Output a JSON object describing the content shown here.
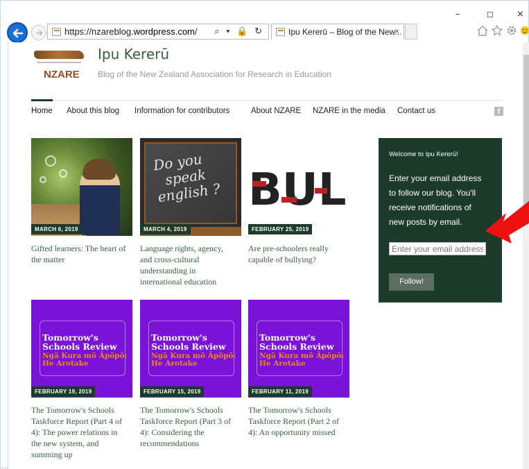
{
  "window": {
    "minimize": "–",
    "maximize": "☐",
    "close": "×"
  },
  "browser": {
    "url_prefix": "https://nzareblog.",
    "url_domain": "wordpress.com",
    "url_suffix": "/",
    "address_tools": "⌕ ▾ 🔒 ↻",
    "tab_title": "Ipu Kererū – Blog of the New...",
    "tab_close": "×",
    "icons": [
      "home-icon",
      "star-icon",
      "gear-icon",
      "smiley-icon"
    ]
  },
  "site": {
    "logo_text": "NZARE",
    "title": "Ipu Kererū",
    "tagline": "Blog of the New Zealand Association for Research in Education"
  },
  "nav": {
    "items": [
      "Home",
      "About this blog",
      "Information for contributors",
      "About NZARE",
      "NZARE in the media",
      "Contact us"
    ],
    "social": "f"
  },
  "posts": [
    {
      "date": "MARCH 6, 2019",
      "title": [
        "Gifted learners: The heart of",
        "the matter"
      ]
    },
    {
      "date": "MARCH 4, 2019",
      "title": [
        "Language rights, agency,",
        "and cross-cultural",
        "understanding in",
        "international education"
      ],
      "image_text": [
        "Do you",
        "speak",
        "english ?"
      ]
    },
    {
      "date": "FEBRUARY 25, 2019",
      "title": [
        "Are pre-schoolers really",
        "capable of bullying?"
      ],
      "image_text": "BULLY"
    },
    {
      "date": "FEBRUARY 19, 2019",
      "title": [
        "The Tomorrow's Schools",
        "Taskforce Report (Part 4 of",
        "4): The power relations in",
        "the new system, and",
        "summing up"
      ]
    },
    {
      "date": "FEBRUARY 15, 2019",
      "title": [
        "The Tomorrow's Schools",
        "Taskforce Report (Part 3 of",
        "4): Considering the",
        "recommendations"
      ]
    },
    {
      "date": "FEBRUARY 11, 2019",
      "title": [
        "The Tomorrow's Schools",
        "Taskforce Report (Part 2 of",
        "4): An opportunity missed"
      ]
    }
  ],
  "review_image": {
    "heading": [
      "Tomorrow's",
      "Schools Review"
    ],
    "sub": [
      "Ngā Kura mō Āpōpō:",
      "He Arotake"
    ]
  },
  "widget": {
    "title": "Welcome to Ipu Kererū!",
    "description": [
      "Enter your email address",
      "to follow our blog. You'll",
      "receive notifications of",
      "new posts by email."
    ],
    "placeholder": "Enter your email address",
    "button": "Follow!"
  },
  "colors": {
    "brand_green": "#1c3b2a",
    "title_green": "#345e3b",
    "purple": "#7a12d8",
    "arrow_red": "#ee1111"
  }
}
